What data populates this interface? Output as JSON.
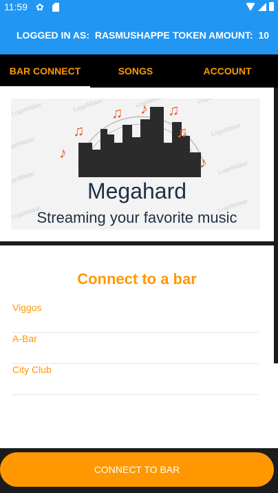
{
  "status_bar": {
    "time": "11:59",
    "icons": [
      "gear-icon",
      "sd-card-icon",
      "wifi-icon",
      "signal-icon",
      "battery-icon"
    ]
  },
  "header": {
    "logged_in_label": "LOGGED IN AS:",
    "username": "RASMUSHAPPE",
    "token_label": "TOKEN AMOUNT:",
    "token_amount": "10"
  },
  "tabs": [
    {
      "label": "BAR CONNECT",
      "active": true
    },
    {
      "label": "SONGS",
      "active": false
    },
    {
      "label": "ACCOUNT",
      "active": false
    }
  ],
  "logo": {
    "title": "Megahard",
    "subtitle": "Streaming your favorite music",
    "watermark": "LogoMaker"
  },
  "connect": {
    "heading": "Connect to a bar",
    "bars": [
      "Viggos",
      "A-Bar",
      "City Club"
    ]
  },
  "button": {
    "label": "CONNECT TO BAR"
  },
  "colors": {
    "primary": "#2196f3",
    "accent": "#ff9800",
    "tab_bg": "#000000",
    "logo_text": "#1f2f44",
    "notes": "#e8602c"
  }
}
